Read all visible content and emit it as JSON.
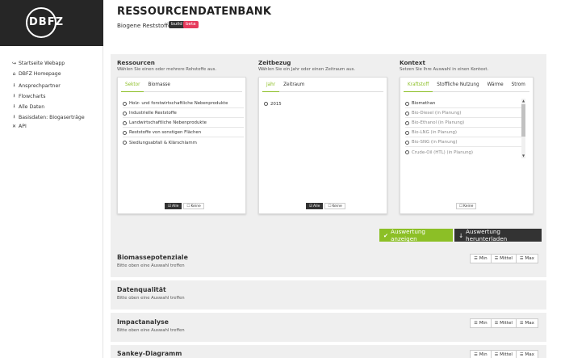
{
  "logo": "DBFZ",
  "header": {
    "title": "RESSOURCENDATENBANK",
    "subtitle": "Biogene Reststoffe",
    "badges": [
      "build",
      "beta"
    ],
    "badge_colors": {
      "build": "#333333",
      "beta": "#e53b5c"
    }
  },
  "sidebar": {
    "items": [
      {
        "icon": "sign-out-icon",
        "label": "Startseite Webapp"
      },
      {
        "icon": "home-icon",
        "label": "DBFZ Homepage"
      },
      {
        "icon": "download-icon",
        "label": "Ansprechpartner"
      },
      {
        "icon": "download-icon",
        "label": "Flowcharts"
      },
      {
        "icon": "download-icon",
        "label": "Alle Daten"
      },
      {
        "icon": "download-icon",
        "label": "Basisdaten: Biogaserträge"
      },
      {
        "icon": "close-icon",
        "label": "API"
      }
    ]
  },
  "filters": {
    "ressourcen": {
      "title": "Ressourcen",
      "hint": "Wählen Sie einen oder mehrere Rohstoffe aus.",
      "tabs": [
        "Sektor",
        "Biomasse"
      ],
      "active_tab": "Sektor",
      "options": [
        "Holz- und forstwirtschaftliche Nebenprodukte",
        "Industrielle Reststoffe",
        "Landwirtschaftliche Nebenprodukte",
        "Reststoffe von sonstigen Flächen",
        "Siedlungsabfall & Klärschlamm"
      ],
      "buttons": {
        "all": "Alle",
        "none": "Keine"
      }
    },
    "zeitbezug": {
      "title": "Zeitbezug",
      "hint": "Wählen Sie ein Jahr oder einen Zeitraum aus.",
      "tabs": [
        "Jahr",
        "Zeitraum"
      ],
      "active_tab": "Jahr",
      "options": [
        "2015"
      ],
      "buttons": {
        "all": "Alle",
        "none": "Keine"
      }
    },
    "kontext": {
      "title": "Kontext",
      "hint": "Setzen Sie Ihre Auswahl in einen Kontext.",
      "tabs": [
        "Kraftstoff",
        "Stoffliche Nutzung",
        "Wärme",
        "Strom"
      ],
      "active_tab": "Kraftstoff",
      "options": [
        "Biomethan",
        "Bio-Diesel (in Planung)",
        "Bio-Ethanol (in Planung)",
        "Bio-LNG (in Planung)",
        "Bio-SNG (in Planung)",
        "Crude-Oil (HTL) (in Planung)"
      ],
      "buttons": {
        "none": "Keine"
      }
    }
  },
  "actions": {
    "show": "Auswertung anzeigen",
    "download": "Auswertung herunterladen",
    "accent_color": "#8cbf26"
  },
  "sections": [
    {
      "title": "Biomassepotenziale",
      "hint": "Bitte oben eine Auswahl treffen",
      "views": [
        "Min",
        "Mittel",
        "Max"
      ]
    },
    {
      "title": "Datenqualität",
      "hint": "Bitte oben eine Auswahl treffen",
      "views": []
    },
    {
      "title": "Impactanalyse",
      "hint": "Bitte oben eine Auswahl treffen",
      "views": [
        "Min",
        "Mittel",
        "Max"
      ]
    },
    {
      "title": "Sankey-Diagramm",
      "hint": "",
      "views": [
        "Min",
        "Mittel",
        "Max"
      ]
    }
  ]
}
